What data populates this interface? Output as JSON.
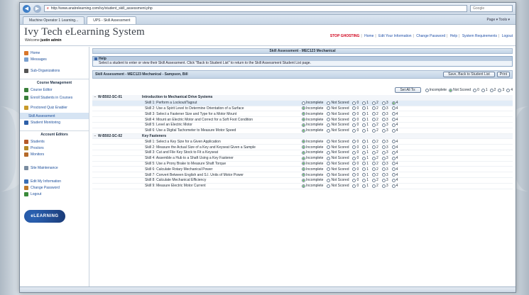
{
  "browser": {
    "url": "http://www.anatrelearning.com/ivy/student_skill_assessment.php",
    "search_placeholder": "Google",
    "tabs": [
      {
        "label": "Machine Operator 1 Learning..."
      },
      {
        "label": "UPS - Skill Assessment"
      }
    ],
    "command_bar": "Page ▾  Tools ▾"
  },
  "app": {
    "title": "Ivy Tech eLearning System",
    "welcome_prefix": "Welcome",
    "welcome_user": "justin admin"
  },
  "top_links": {
    "stop_ghosting": "STOP GHOSTING",
    "items": [
      "Home",
      "Edit Your Information",
      "Change Password",
      "Help",
      "System Requirements",
      "Logout"
    ]
  },
  "sidebar": {
    "top_items": [
      {
        "label": "Home",
        "icon": "home-icon",
        "color": "#d9772b"
      },
      {
        "label": "Messages",
        "icon": "messages-icon",
        "color": "#7aa0cf"
      }
    ],
    "sub_org": {
      "label": "Sub-Organizations",
      "icon": "sub-org-icon",
      "color": "#555"
    },
    "course_management": {
      "heading": "Course Management",
      "items": [
        {
          "label": "Course Editor",
          "icon": "course-editor-icon",
          "color": "#3a7f3a"
        },
        {
          "label": "Enroll Students in Courses",
          "icon": "enroll-icon",
          "color": "#3a7f3a"
        },
        {
          "label": "Proctored Quiz Enabler",
          "icon": "proctor-quiz-icon",
          "color": "#c89a2a"
        },
        {
          "label": "Skill Assessment",
          "icon": "",
          "color": ""
        },
        {
          "label": "Student Monitoring",
          "icon": "monitoring-icon",
          "color": "#2e5fa8"
        }
      ]
    },
    "account_editors": {
      "heading": "Account Editors",
      "items": [
        {
          "label": "Students",
          "icon": "students-icon",
          "color": "#b55a2a"
        },
        {
          "label": "Proctors",
          "icon": "proctors-icon",
          "color": "#b58a2a"
        },
        {
          "label": "Monitors",
          "icon": "monitors-icon",
          "color": "#b56a2a"
        }
      ]
    },
    "bottom_items": [
      {
        "label": "Site Maintenance",
        "icon": "maintenance-icon",
        "color": "#7a8ca0"
      },
      {
        "label": "Edit My Information",
        "icon": "edit-info-icon",
        "color": "#3a6fb5"
      },
      {
        "label": "Change Password",
        "icon": "password-icon",
        "color": "#c07a2a"
      },
      {
        "label": "Logout",
        "icon": "logout-icon",
        "color": "#3a8a3a"
      }
    ],
    "logo_text": "eLEARNING"
  },
  "page": {
    "title": "Skill Assessment - MEC123 Mechanical",
    "help_title": "Help",
    "help_text": "Select a student to enter or view their Skill Assessment. Click \"Back to Student List\" to return to the Skill Assessment Student List page.",
    "student_title": "Skill Assessment - MEC123 Mechanical - Sampson, Bill",
    "save_button": "Save, Back to Student List",
    "print_button": "Print",
    "set_all_button": "Set All To:",
    "options": [
      "Incomplete",
      "Not Scored",
      "0",
      "1",
      "2",
      "3",
      "4"
    ],
    "set_all_selected": 1
  },
  "sections": [
    {
      "code": "W-B502-SC-01",
      "name": "Introduction to Mechanical Drive Systems",
      "skills": [
        {
          "label": "Skill 1: Perform a Lockout/Tagout",
          "selected": 6,
          "highlight": true
        },
        {
          "label": "Skill 2: Use a Spirit Level to Determine Orientation of a Surface",
          "selected": 0
        },
        {
          "label": "Skill 3: Select a Fastener Size and Type for a Motor Mount",
          "selected": 0
        },
        {
          "label": "Skill 4: Mount an Electric Motor and Correct for a Soft Foot Condition",
          "selected": 0
        },
        {
          "label": "Skill 5: Level an Electric Motor",
          "selected": 0
        },
        {
          "label": "Skill 6: Use a Digital Tachometer to Measure Motor Speed",
          "selected": 0
        }
      ]
    },
    {
      "code": "W-B502-SC-02",
      "name": "Key Fasteners",
      "skills": [
        {
          "label": "Skill 1: Select a Key Size for a Given Application",
          "selected": 0
        },
        {
          "label": "Skill 2: Measure the Actual Size of a Key and Keyseat Given a Sample",
          "selected": 0
        },
        {
          "label": "Skill 3: Cut and File Key Stock to Fit a Keyseat",
          "selected": 0
        },
        {
          "label": "Skill 4: Assemble a Hub to a Shaft Using a Key Fastener",
          "selected": 0
        },
        {
          "label": "Skill 5: Use a Prony Brake to Measure Shaft Torque",
          "selected": 0
        },
        {
          "label": "Skill 6: Calculate Rotary Mechanical Power",
          "selected": 0
        },
        {
          "label": "Skill 7: Convert Between English and S.I. Units of Motor Power",
          "selected": 0
        },
        {
          "label": "Skill 8: Calculate Mechanical Efficiency",
          "selected": 0
        },
        {
          "label": "Skill 9: Measure Electric Motor Current",
          "selected": 0
        }
      ]
    }
  ]
}
